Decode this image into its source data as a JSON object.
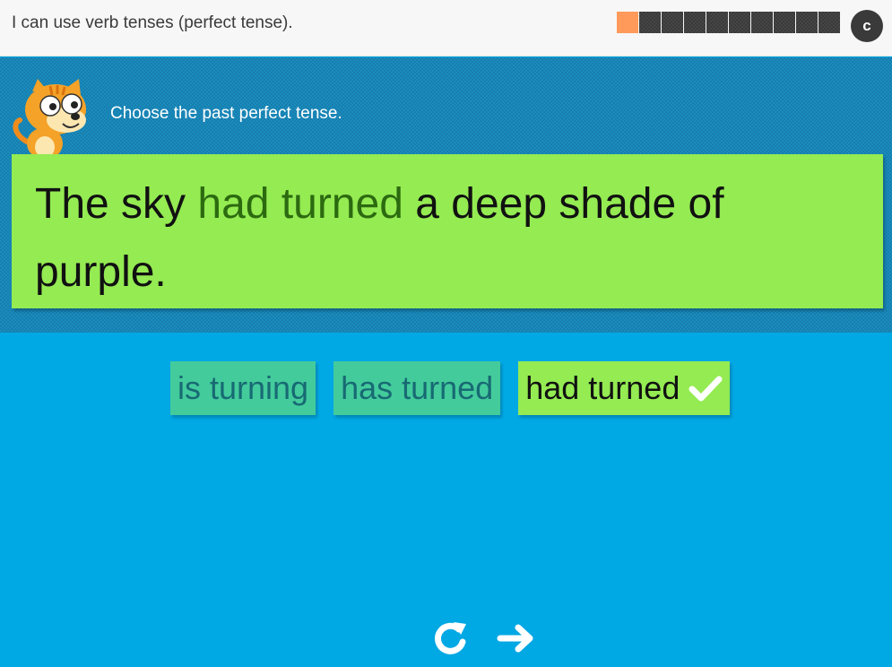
{
  "header": {
    "objective": "I can use verb tenses (perfect tense).",
    "progress": {
      "total": 10,
      "completed": 1
    },
    "menu_label": "c"
  },
  "question": {
    "instruction": "Choose the past perfect tense.",
    "sentence_before": "The sky ",
    "sentence_answer": "had turned",
    "sentence_after": " a deep shade of purple."
  },
  "choices": [
    {
      "label": "is turning",
      "selected": false
    },
    {
      "label": "has turned",
      "selected": false
    },
    {
      "label": "had turned",
      "selected": true
    }
  ],
  "colors": {
    "background": "#00a8e4",
    "card_green": "#94eb52",
    "choice_teal": "#44cb9c",
    "progress_done": "#ff9a5a",
    "progress_todo": "#3a3a3a"
  },
  "icons": {
    "menu": "menu-c-icon",
    "retry": "retry-icon",
    "next": "next-arrow-icon",
    "check": "check-icon",
    "mascot": "cat-mascot-icon"
  }
}
